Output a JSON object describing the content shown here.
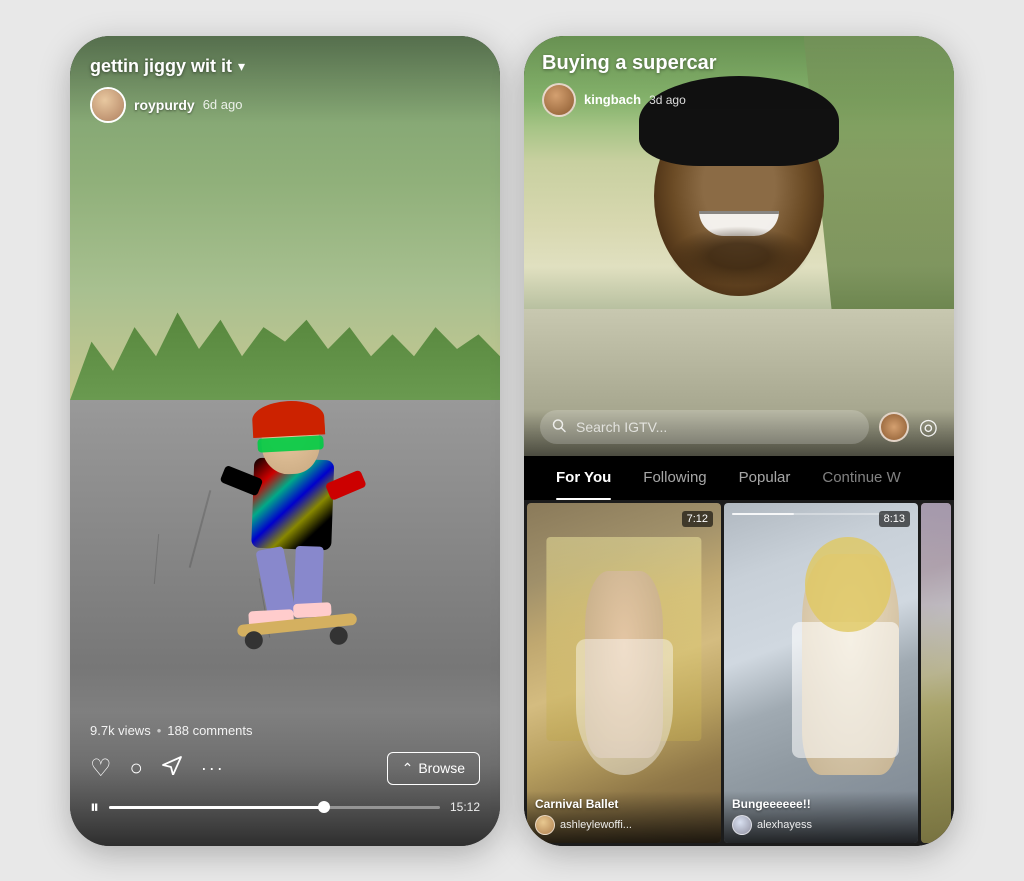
{
  "left_phone": {
    "video_title": "gettin jiggy wit it",
    "user": {
      "name": "roypurdy",
      "time_ago": "6d ago"
    },
    "stats": {
      "views": "9.7k views",
      "comments": "188 comments"
    },
    "browse_btn": "Browse",
    "time_current": "15:12",
    "progress_pct": 65
  },
  "right_phone": {
    "video_title": "Buying a supercar",
    "user": {
      "name": "kingbach",
      "time_ago": "3d ago"
    },
    "search_placeholder": "Search IGTV...",
    "tabs": [
      {
        "label": "For You",
        "active": true
      },
      {
        "label": "Following",
        "active": false
      },
      {
        "label": "Popular",
        "active": false
      },
      {
        "label": "Continue W",
        "active": false
      }
    ],
    "thumbnails": [
      {
        "title": "Carnival Ballet",
        "username": "ashleylewoffi...",
        "duration": "7:12",
        "has_progress": false
      },
      {
        "title": "Bungeeeeee!!",
        "username": "alexhayess",
        "duration": "8:13",
        "has_progress": true
      },
      {
        "title": "",
        "username": "",
        "duration": "",
        "has_progress": false
      }
    ]
  },
  "icons": {
    "dropdown": "▾",
    "heart": "♡",
    "comment": "💬",
    "send": "➤",
    "more": "•••",
    "browse_arrow": "⌃",
    "pause": "⏸",
    "search": "🔍",
    "settings": "◎"
  }
}
